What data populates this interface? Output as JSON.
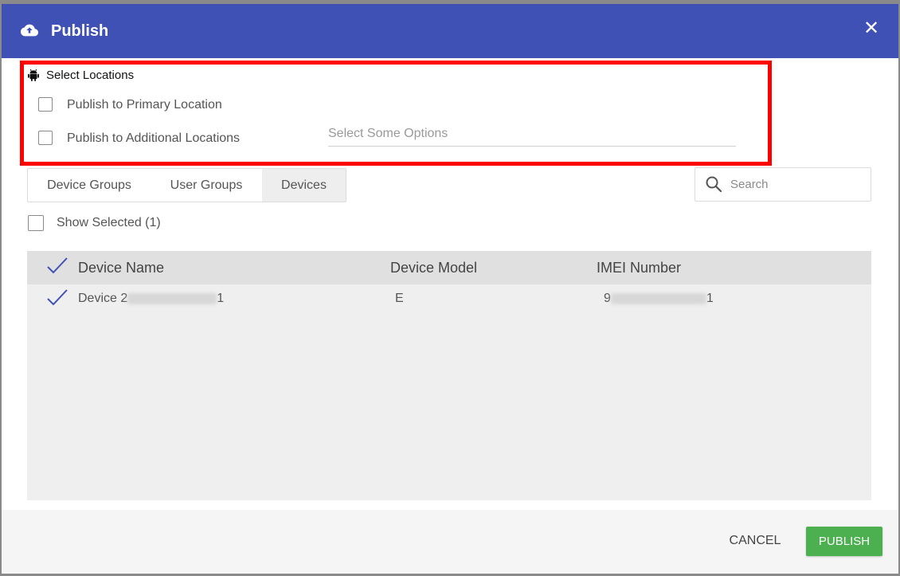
{
  "dialog": {
    "title": "Publish",
    "close_label": "✕"
  },
  "locations": {
    "title": "Select Locations",
    "primary_label": "Publish to Primary Location",
    "primary_checked": false,
    "additional_label": "Publish to Additional Locations",
    "additional_checked": false,
    "select_placeholder": "Select Some Options"
  },
  "tabs": [
    {
      "label": "Device Groups",
      "active": false
    },
    {
      "label": "User Groups",
      "active": false
    },
    {
      "label": "Devices",
      "active": true
    }
  ],
  "search": {
    "placeholder": "Search"
  },
  "show_selected": {
    "label": "Show Selected (1)",
    "checked": false
  },
  "table": {
    "columns": [
      "Device Name",
      "Device Model",
      "IMEI Number"
    ],
    "rows": [
      {
        "selected": true,
        "name_visible_prefix": "Device 2",
        "name_visible_suffix": "1",
        "model": "E",
        "imei_visible_prefix": "9",
        "imei_visible_suffix": "1"
      }
    ]
  },
  "footer": {
    "cancel_label": "CANCEL",
    "publish_label": "PUBLISH"
  },
  "colors": {
    "header": "#3f51b5",
    "highlight": "#ff0000",
    "publish_button": "#4caf50",
    "checkmark": "#3f51b5"
  }
}
